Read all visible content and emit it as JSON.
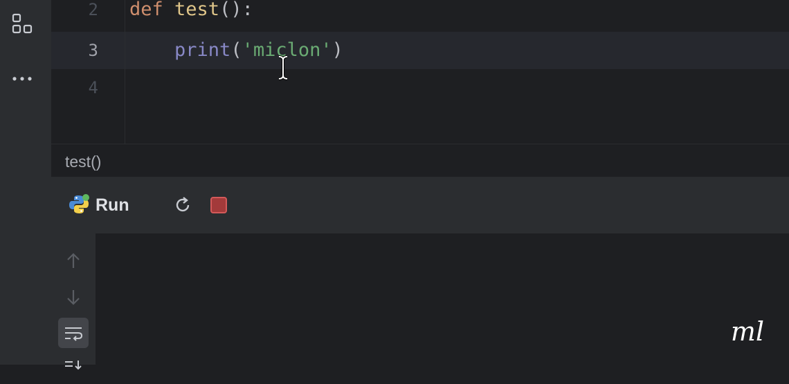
{
  "editor": {
    "lines": [
      {
        "number": "2",
        "tokens": [
          {
            "text": "def ",
            "cls": "kw"
          },
          {
            "text": "test",
            "cls": "fnname"
          },
          {
            "text": "():",
            "cls": ""
          }
        ]
      },
      {
        "number": "3",
        "tokens": [
          {
            "text": "    ",
            "cls": ""
          },
          {
            "text": "print",
            "cls": "bi"
          },
          {
            "text": "(",
            "cls": ""
          },
          {
            "text": "'miclon'",
            "cls": "str"
          },
          {
            "text": ")",
            "cls": ""
          }
        ]
      },
      {
        "number": "4",
        "tokens": []
      }
    ]
  },
  "breadcrumb": "test()",
  "run_panel": {
    "title": "Run"
  },
  "watermark": "ml",
  "icons": {
    "sidebar_top": "structure-icon",
    "sidebar_more": "more-icon",
    "python": "python-icon",
    "rerun": "rerun-icon",
    "stop": "stop-icon",
    "up": "arrow-up-icon",
    "down": "arrow-down-icon",
    "wrap": "soft-wrap-icon",
    "scroll": "scroll-to-end-icon"
  },
  "colors": {
    "stop": "#d45a5a",
    "python_blue": "#4a8bd6",
    "python_yellow": "#f2cf4b"
  }
}
